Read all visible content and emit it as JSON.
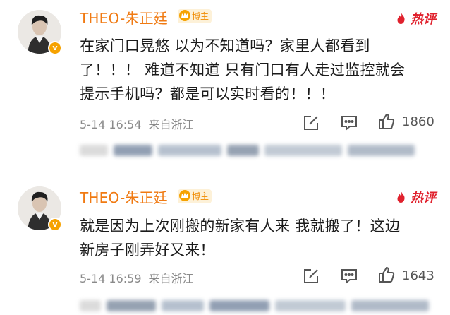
{
  "comments": [
    {
      "username": "THEO-朱正廷",
      "host_badge": "博主",
      "hot_label": "热评",
      "verified_mark": "v",
      "text_lines": [
        "在家门口晃悠 以为不知道吗？家里人都看到",
        "了！！！ 难道不知道 只有门口有人走过监控就会",
        "提示手机吗？都是可以实时看的！！！"
      ],
      "date": "5-14 16:54",
      "source": "来自浙江",
      "likes": "1860",
      "icons": [
        "share-icon",
        "comment-icon",
        "like-icon"
      ]
    },
    {
      "username": "THEO-朱正廷",
      "host_badge": "博主",
      "hot_label": "热评",
      "verified_mark": "v",
      "text_lines": [
        "就是因为上次刚搬的新家有人来 我就搬了！这边",
        "新房子刚弄好又来！"
      ],
      "date": "5-14 16:59",
      "source": "来自浙江",
      "likes": "1643",
      "icons": [
        "share-icon",
        "comment-icon",
        "like-icon"
      ]
    }
  ],
  "colors": {
    "username": "#f07a12",
    "hot": "#e0212d",
    "badge_bg": "#fdf1d8",
    "verified": "#f6a200",
    "meta": "#8a8a8a"
  }
}
